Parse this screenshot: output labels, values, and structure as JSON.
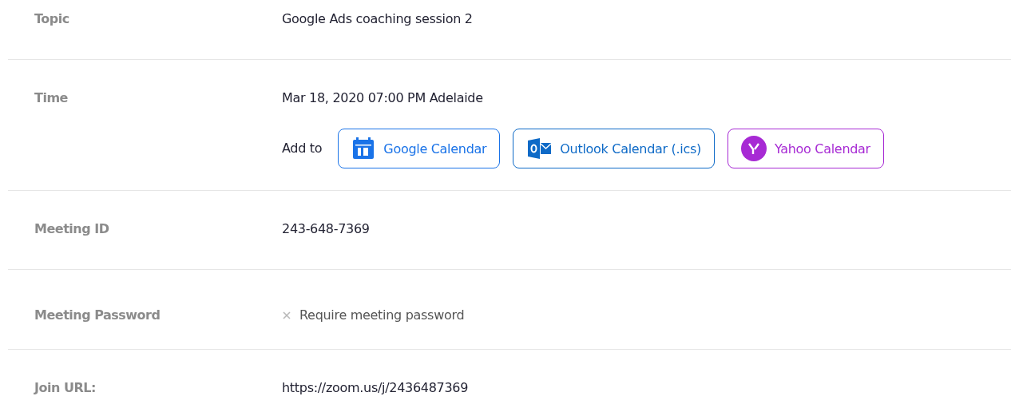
{
  "rows": [
    {
      "kind": "text",
      "label": "Topic",
      "value": "Google Ads coaching session 2"
    },
    {
      "kind": "time",
      "label": "Time",
      "value": "Mar 18, 2020 07:00 PM Adelaide",
      "add_to": "Add to",
      "calendars": [
        {
          "kind": "google",
          "label": "Google Calendar",
          "color": "#1a73e8"
        },
        {
          "kind": "outlook",
          "label": "Outlook Calendar (.ics)",
          "color": "#0e6ac7"
        },
        {
          "kind": "yahoo",
          "label": "Yahoo Calendar",
          "color": "#a72ad4"
        }
      ]
    },
    {
      "kind": "text",
      "label": "Meeting ID",
      "value": "243-648-7369"
    },
    {
      "kind": "option",
      "label": "Meeting Password",
      "value": "Require meeting password",
      "checked": false
    },
    {
      "kind": "text",
      "label": "Join URL:",
      "value": "https://zoom.us/j/2436487369"
    }
  ]
}
